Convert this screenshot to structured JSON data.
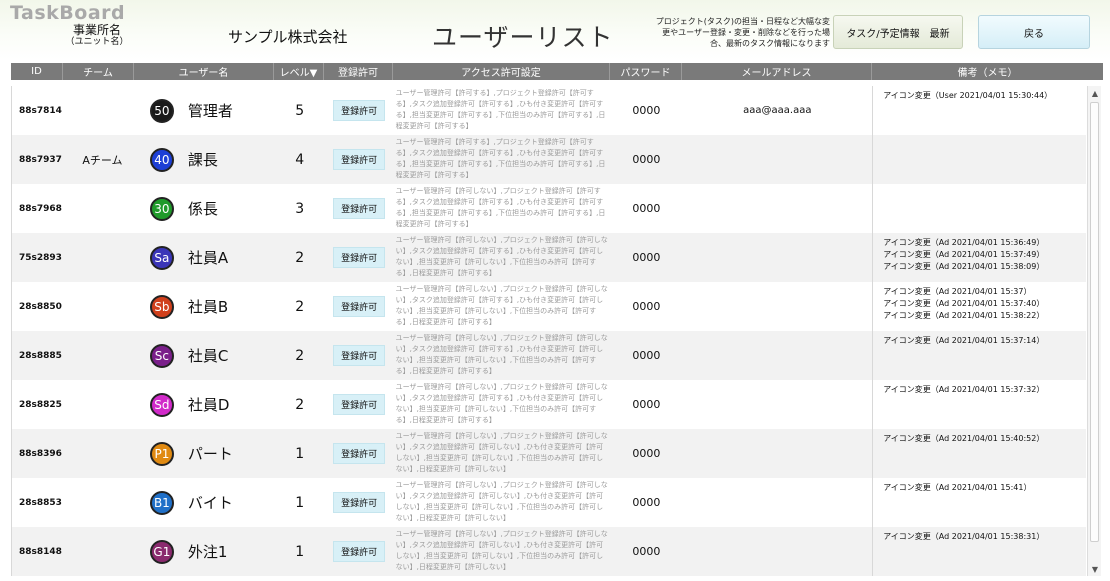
{
  "header": {
    "logo": "TaskBoard",
    "office_name": "事業所名",
    "office_unit": "（ユニット名）",
    "company": "サンプル株式会社",
    "title": "ユーザーリスト",
    "note": "プロジェクト(タスク)の担当・日程など大幅な変更やユーザー登録・変更・削除などを行った場合、最新のタスク情報になります",
    "refresh_button": "タスク/予定情報　最新",
    "back_button": "戻る"
  },
  "columns": [
    "ID",
    "チーム",
    "ユーザー名",
    "レベル▼",
    "登録許可",
    "アクセス許可設定",
    "パスワード",
    "メールアドレス",
    "備考（メモ）"
  ],
  "rows": [
    {
      "id": "88s7814",
      "team": "",
      "avatar": "50",
      "avatar_color": "#1a1a1a",
      "name": "管理者",
      "level": "5",
      "reg": "登録許可",
      "access": "ユーザー管理許可【許可する】,プロジェクト登録許可【許可する】,タスク追加登録許可【許可する】,ひも付き変更許可【許可する】,担当変更許可【許可する】,下位担当のみ許可【許可する】,日程変更許可【許可する】",
      "password": "0000",
      "email": "aaa@aaa.aaa",
      "memo": [
        "アイコン変更（User 2021/04/01 15:30:44）"
      ]
    },
    {
      "id": "88s7937",
      "team": "Aチーム",
      "avatar": "40",
      "avatar_color": "#1d3fd6",
      "name": "課長",
      "level": "4",
      "reg": "登録許可",
      "access": "ユーザー管理許可【許可する】,プロジェクト登録許可【許可する】,タスク追加登録許可【許可する】,ひも付き変更許可【許可する】,担当変更許可【許可する】,下位担当のみ許可【許可する】,日程変更許可【許可する】",
      "password": "0000",
      "email": "",
      "memo": []
    },
    {
      "id": "88s7968",
      "team": "",
      "avatar": "30",
      "avatar_color": "#1f9a2a",
      "name": "係長",
      "level": "3",
      "reg": "登録許可",
      "access": "ユーザー管理許可【許可しない】,プロジェクト登録許可【許可する】,タスク追加登録許可【許可する】,ひも付き変更許可【許可する】,担当変更許可【許可する】,下位担当のみ許可【許可する】,日程変更許可【許可する】",
      "password": "0000",
      "email": "",
      "memo": []
    },
    {
      "id": "75s2893",
      "team": "",
      "avatar": "Sa",
      "avatar_color": "#3a35b8",
      "name": "社員A",
      "level": "2",
      "reg": "登録許可",
      "access": "ユーザー管理許可【許可しない】,プロジェクト登録許可【許可しない】,タスク追加登録許可【許可する】,ひも付き変更許可【許可しない】,担当変更許可【許可しない】,下位担当のみ許可【許可する】,日程変更許可【許可する】",
      "password": "0000",
      "email": "",
      "memo": [
        "アイコン変更（Ad 2021/04/01 15:36:49）",
        "アイコン変更（Ad 2021/04/01 15:37:49）",
        "アイコン変更（Ad 2021/04/01 15:38:09）"
      ]
    },
    {
      "id": "28s8850",
      "team": "",
      "avatar": "Sb",
      "avatar_color": "#d0401c",
      "name": "社員B",
      "level": "2",
      "reg": "登録許可",
      "access": "ユーザー管理許可【許可しない】,プロジェクト登録許可【許可しない】,タスク追加登録許可【許可する】,ひも付き変更許可【許可しない】,担当変更許可【許可しない】,下位担当のみ許可【許可する】,日程変更許可【許可する】",
      "password": "0000",
      "email": "",
      "memo": [
        "アイコン変更（Ad 2021/04/01 15:37）",
        "アイコン変更（Ad 2021/04/01 15:37:40）",
        "アイコン変更（Ad 2021/04/01 15:38:22）"
      ]
    },
    {
      "id": "28s8885",
      "team": "",
      "avatar": "Sc",
      "avatar_color": "#7a1f8a",
      "name": "社員C",
      "level": "2",
      "reg": "登録許可",
      "access": "ユーザー管理許可【許可しない】,プロジェクト登録許可【許可しない】,タスク追加登録許可【許可する】,ひも付き変更許可【許可しない】,担当変更許可【許可しない】,下位担当のみ許可【許可する】,日程変更許可【許可する】",
      "password": "0000",
      "email": "",
      "memo": [
        "アイコン変更（Ad 2021/04/01 15:37:14）"
      ]
    },
    {
      "id": "28s8825",
      "team": "",
      "avatar": "Sd",
      "avatar_color": "#d12ac9",
      "name": "社員D",
      "level": "2",
      "reg": "登録許可",
      "access": "ユーザー管理許可【許可しない】,プロジェクト登録許可【許可しない】,タスク追加登録許可【許可する】,ひも付き変更許可【許可しない】,担当変更許可【許可しない】,下位担当のみ許可【許可する】,日程変更許可【許可する】",
      "password": "0000",
      "email": "",
      "memo": [
        "アイコン変更（Ad 2021/04/01 15:37:32）"
      ]
    },
    {
      "id": "88s8396",
      "team": "",
      "avatar": "P1",
      "avatar_color": "#e08a12",
      "name": "パート",
      "level": "1",
      "reg": "登録許可",
      "access": "ユーザー管理許可【許可しない】,プロジェクト登録許可【許可しない】,タスク追加登録許可【許可しない】,ひも付き変更許可【許可しない】,担当変更許可【許可しない】,下位担当のみ許可【許可しない】,日程変更許可【許可しない】",
      "password": "0000",
      "email": "",
      "memo": [
        "アイコン変更（Ad 2021/04/01 15:40:52）"
      ]
    },
    {
      "id": "28s8853",
      "team": "",
      "avatar": "B1",
      "avatar_color": "#2070c8",
      "name": "バイト",
      "level": "1",
      "reg": "登録許可",
      "access": "ユーザー管理許可【許可しない】,プロジェクト登録許可【許可しない】,タスク追加登録許可【許可しない】,ひも付き変更許可【許可しない】,担当変更許可【許可しない】,下位担当のみ許可【許可しない】,日程変更許可【許可しない】",
      "password": "0000",
      "email": "",
      "memo": [
        "アイコン変更（Ad 2021/04/01 15:41）"
      ]
    },
    {
      "id": "88s8148",
      "team": "",
      "avatar": "G1",
      "avatar_color": "#8a2a6e",
      "name": "外注1",
      "level": "1",
      "reg": "登録許可",
      "access": "ユーザー管理許可【許可しない】,プロジェクト登録許可【許可しない】,タスク追加登録許可【許可しない】,ひも付き変更許可【許可しない】,担当変更許可【許可しない】,下位担当のみ許可【許可しない】,日程変更許可【許可しない】",
      "password": "0000",
      "email": "",
      "memo": [
        "アイコン変更（Ad 2021/04/01 15:38:31）"
      ]
    }
  ],
  "scrollbar": {
    "up_icon": "chevron-up-icon",
    "down_icon": "chevron-down-icon"
  }
}
